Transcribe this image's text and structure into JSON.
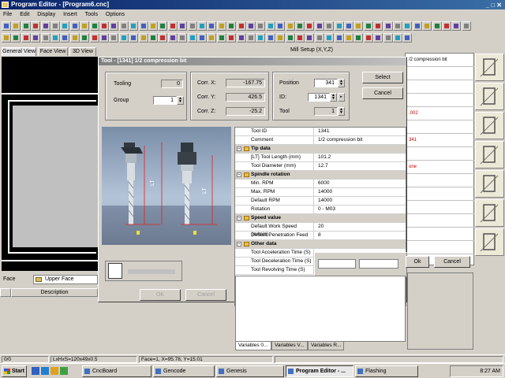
{
  "window": {
    "title": "Program Editor - [Program6.cnc]",
    "controls": "_ □ ✕"
  },
  "menu": [
    "File",
    "Edit",
    "Display",
    "Insert",
    "Tools",
    "Options"
  ],
  "left_tabs": [
    "General View",
    "Face View",
    "3D View"
  ],
  "face": {
    "label": "Face",
    "value": "Upper Face"
  },
  "description_header": "Description",
  "mill_setup_label": "Mill Setup (X,Y,Z)",
  "right_panel": {
    "rows": [
      {
        "text": "/2 compression bit",
        "red": false
      },
      {
        "text": "",
        "red": false
      },
      {
        "text": "",
        "red": false
      },
      {
        "text": "",
        "red": false
      },
      {
        "text": ".002",
        "red": true
      },
      {
        "text": "",
        "red": false
      },
      {
        "text": "341",
        "red": true
      },
      {
        "text": "",
        "red": false
      },
      {
        "text": "one",
        "red": true
      },
      {
        "text": "",
        "red": false
      },
      {
        "text": "",
        "red": false
      },
      {
        "text": "",
        "red": false
      },
      {
        "text": "",
        "red": false
      },
      {
        "text": "",
        "red": false
      },
      {
        "text": "",
        "red": false
      }
    ]
  },
  "right_icons": [
    "drill-tool-icon",
    "tool-holder-icon",
    "line-icon",
    "arc-icon",
    "ellipse-icon",
    "lathe-icon",
    "machine-icon"
  ],
  "dialog": {
    "title": "Tool - [1341] 1/2 compression bit",
    "tooling_label": "Tooling",
    "tooling_value": "0",
    "group_label": "Group",
    "group_value": "1",
    "corr_x_label": "Corr. X:",
    "corr_x": "-167.75",
    "corr_y_label": "Corr. Y:",
    "corr_y": "426.5",
    "corr_z_label": "Corr. Z:",
    "corr_z": "-25.2",
    "position_label": "Position",
    "position_value": "341",
    "id_label": "ID:",
    "id_value": "1341",
    "tool_label": "Tool",
    "tool_value": "1",
    "select_button": "Select",
    "cancel_button": "Cancel",
    "ok_button": "OK",
    "cancel2_button": "Cancel",
    "ok_outer": "Ok",
    "cancel_outer": "Cancel",
    "lt_label": "LT"
  },
  "properties": [
    {
      "type": "row",
      "name": "Tool ID",
      "value": "1341"
    },
    {
      "type": "row",
      "name": "Comment",
      "value": "1/2 compression bit"
    },
    {
      "type": "group",
      "name": "Tip data"
    },
    {
      "type": "row",
      "name": "[LT] Tool Length (mm)",
      "value": "101.2"
    },
    {
      "type": "row",
      "name": "Tool Diameter (mm)",
      "value": "12.7"
    },
    {
      "type": "group",
      "name": "Spindle rotation"
    },
    {
      "type": "row",
      "name": "Min. RPM",
      "value": "6000"
    },
    {
      "type": "row",
      "name": "Max. RPM",
      "value": "14000"
    },
    {
      "type": "row",
      "name": "Default RPM",
      "value": "14000"
    },
    {
      "type": "row",
      "name": "Rotation",
      "value": "0 - M03"
    },
    {
      "type": "group",
      "name": "Speed value"
    },
    {
      "type": "row",
      "name": "Default Work Speed (m/min)",
      "value": "20"
    },
    {
      "type": "row",
      "name": "Default Penetration Feed (m/min)",
      "value": "8"
    },
    {
      "type": "group",
      "name": "Other data"
    },
    {
      "type": "row",
      "name": "Tool Acceleration Time (S)",
      "value": ""
    },
    {
      "type": "row",
      "name": "Tool Deceleration Time (S)",
      "value": ""
    },
    {
      "type": "row",
      "name": "Tool Revolving Time (S)",
      "value": ""
    }
  ],
  "variables_tabs": [
    "Variables 0...",
    "Variables V...",
    "Variables R..."
  ],
  "status": {
    "cell1": "0/0",
    "cell2": "LxHxS=120x49x0.5",
    "cell3": "Face=1, X=95.78, Y=15.01"
  },
  "taskbar": {
    "start": "Start",
    "tasks": [
      "CncBoard",
      "Gencode",
      "Genesis",
      "Program Editor - ...",
      "Flashing"
    ],
    "active_index": 3,
    "clock": "8:27 AM"
  },
  "colors": {
    "title_start": "#0a246a",
    "title_end": "#3a6ea5",
    "red_text": "#c00000",
    "dialog_bg": "#d4d0c8"
  }
}
